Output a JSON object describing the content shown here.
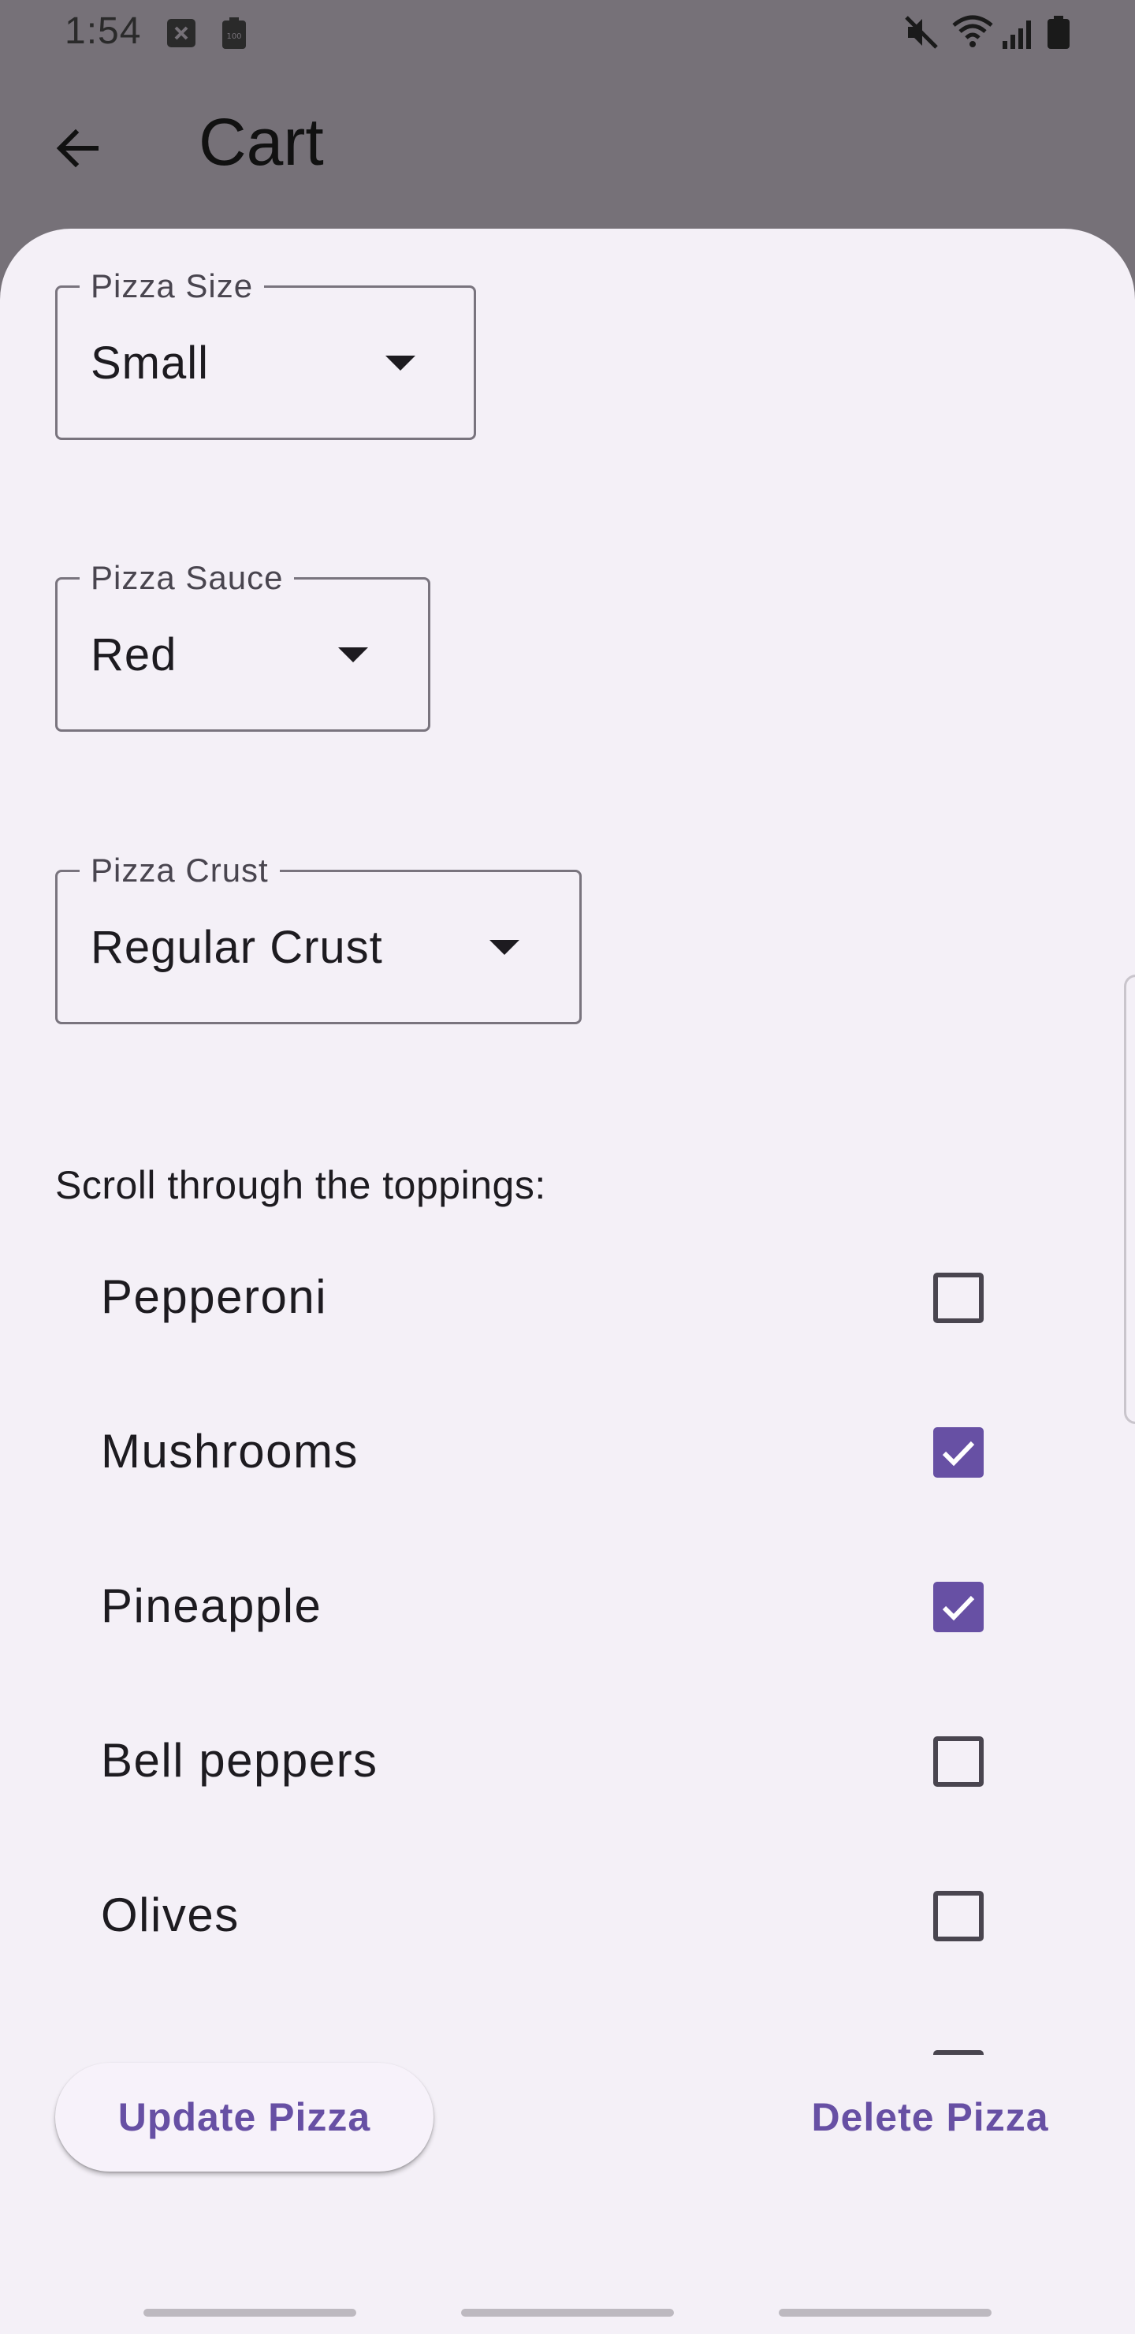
{
  "status_bar": {
    "time": "1:54",
    "left_icons": [
      "notification-blocked-icon",
      "battery-saver-icon"
    ],
    "right_icons": [
      "mute-icon",
      "wifi-icon",
      "signal-icon",
      "battery-icon"
    ]
  },
  "app_bar": {
    "title": "Cart",
    "back_icon": "arrow-back-icon"
  },
  "form": {
    "size": {
      "label": "Pizza Size",
      "value": "Small"
    },
    "sauce": {
      "label": "Pizza Sauce",
      "value": "Red"
    },
    "crust": {
      "label": "Pizza Crust",
      "value": "Regular Crust"
    }
  },
  "toppings": {
    "title": "Scroll through the toppings:",
    "items": [
      {
        "label": "Pepperoni",
        "checked": false
      },
      {
        "label": "Mushrooms",
        "checked": true
      },
      {
        "label": "Pineapple",
        "checked": true
      },
      {
        "label": "Bell peppers",
        "checked": false
      },
      {
        "label": "Olives",
        "checked": false
      }
    ]
  },
  "actions": {
    "update_label": "Update Pizza",
    "delete_label": "Delete Pizza"
  },
  "colors": {
    "accent": "#6750a4",
    "sheet_bg": "#f4f0f7",
    "scrim": "#767178",
    "outline": "#79747e"
  }
}
